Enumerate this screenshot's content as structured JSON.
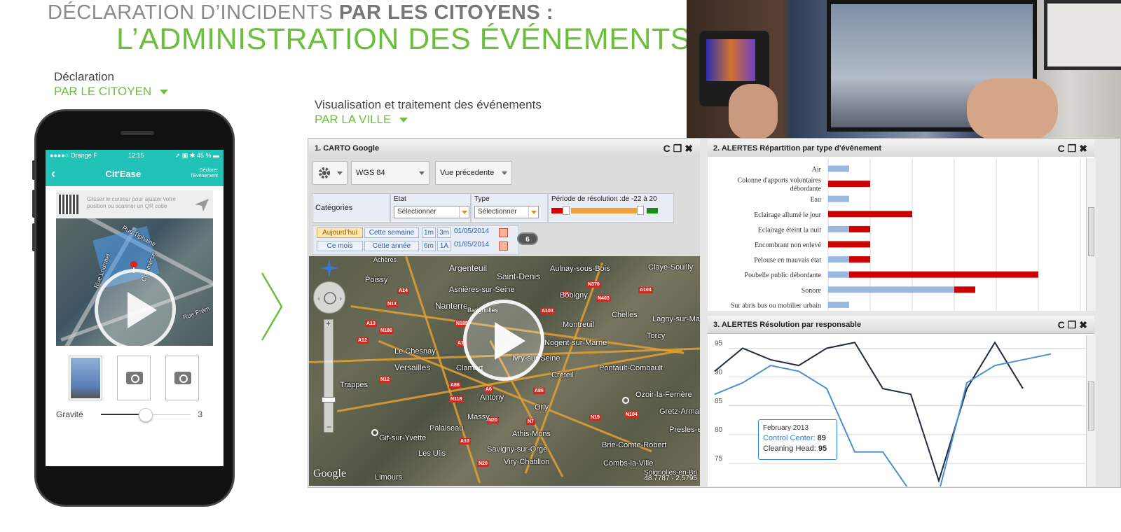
{
  "header": {
    "line1_plain": "DÉCLARATION D’INCIDENTS ",
    "line1_bold": "PAR LES CITOYENS :",
    "line2": "L’ADMINISTRATION DES ÉVÉNEMENTS"
  },
  "citizen": {
    "label": "Déclaration",
    "sub": "PAR LE CITOYEN"
  },
  "city": {
    "label": "Visualisation et traitement des événements",
    "sub": "PAR LA VILLE"
  },
  "phone": {
    "carrier": "●●●●○ Orange F",
    "time": "12:15",
    "battery": "45 %",
    "app_title": "Cit'Ease",
    "action_line1": "Déclarer",
    "action_line2": "l'Evènement",
    "hint": "Glisser le curseur pour ajuster votre position ou scanner un QR code",
    "map_labels": [
      "Rue Tiphaine",
      "Rue Lourmel",
      "Commerce",
      "Rue Frém"
    ],
    "gravity_label": "Gravité",
    "gravity_value": "3",
    "gravity_level": 0.5
  },
  "panel1": {
    "title": "1. CARTO Google",
    "projection": "WGS 84",
    "view": "Vue précedente",
    "categories_label": "Catégories",
    "etat_label": "Etat",
    "etat_value": "Sélectionner",
    "type_label": "Type",
    "type_value": "Sélectionner",
    "period_label": "Période de résolution :de -22 à 20",
    "date_buttons_row1": [
      "Aujourd'hui",
      "Cette semaine",
      "1m",
      "3m"
    ],
    "date_buttons_row2": [
      "Ce mois",
      "Cette année",
      "6m",
      "1A"
    ],
    "date1": "01/05/2014",
    "date2": "01/05/2014",
    "badge": "6",
    "map_labels": [
      "Argenteuil",
      "Saint-Denis",
      "Aulnay-sous-Bois",
      "Claye-Souilly",
      "Poissy",
      "Asnières-sur-Seine",
      "Bobigny",
      "Nanterre",
      "Batignolles",
      "Chelles",
      "Lagny-sur-Ma",
      "Montreuil",
      "Le Chesnay",
      "Nogent-sur-Marne",
      "Torcy",
      "Versailles",
      "Clamart",
      "Ivry-sur-Seine",
      "Pontault-Combault",
      "Trappes",
      "Créteil",
      "Antony",
      "Orly",
      "Ozoir-la-Ferrière",
      "Massy",
      "Gretz-Armai",
      "Palaiseau",
      "Athis-Mons",
      "Gif-sur-Yvette",
      "Presles-e",
      "Les Ulis",
      "Savigny-sur-Orge",
      "Brie-Comte-Robert",
      "Viry-Châtillon",
      "Combs-la-Ville",
      "Soignolles-en-Bri",
      "Limours",
      "Achères"
    ],
    "google": "Google",
    "coords": "48.7787 · 2.5795"
  },
  "panel2": {
    "title": "2. ALERTES Répartition par type d'évènement"
  },
  "panel3": {
    "title": "3. ALERTES Résolution par responsable",
    "tooltip_date": "February 2013",
    "tooltip_s1_label": "Control Center:",
    "tooltip_s1_value": "89",
    "tooltip_s2_label": "Cleaning Head:",
    "tooltip_s2_value": "95"
  },
  "icons": {
    "refresh": "C",
    "restore": "❐",
    "close": "✖"
  },
  "colors": {
    "green": "#6cbf3c",
    "teal": "#21c2b7",
    "bar_red": "#cc0000",
    "bar_blue": "#9ab8e0",
    "line_dark": "#1f2a44",
    "line_blue": "#4a90d0"
  },
  "chart_data": [
    {
      "type": "bar",
      "orientation": "horizontal",
      "stacked": true,
      "categories": [
        "Air",
        "Colonne d'apports volontaires débordante",
        "Eau",
        "Eclairage allumé le jour",
        "Eclairage éteint la nuit",
        "Encombrant non enlevé",
        "Pelouse en mauvais état",
        "Poubelle public débordante",
        "Sonore",
        "Sur abris bus ou mobilier urbain"
      ],
      "category_lines": [
        [
          "Air"
        ],
        [
          "Colonne d'apports volontaires",
          "débordante"
        ],
        [
          "Eau"
        ],
        [
          "Eclairage allumé le jour"
        ],
        [
          "Eclairage éteint la nuit"
        ],
        [
          "Encombrant non enlevé"
        ],
        [
          "Pelouse en mauvais état"
        ],
        [
          "Poubelle public débordante"
        ],
        [
          "Sonore"
        ],
        [
          "Sur abris bus ou mobilier urbain"
        ]
      ],
      "series": [
        {
          "color": "#9ab8e0",
          "values": [
            1,
            0,
            1,
            0,
            1,
            0,
            1,
            1,
            6,
            1
          ]
        },
        {
          "color": "#cc0000",
          "values": [
            0,
            2,
            0,
            4,
            1,
            2,
            1,
            9,
            1,
            0
          ]
        }
      ],
      "xlim": [
        0,
        14
      ],
      "grid": true
    },
    {
      "type": "line",
      "y_ticks": [
        75,
        80,
        85,
        90,
        95
      ],
      "ylim": [
        71,
        97
      ],
      "series": [
        {
          "color": "#1f2a44",
          "values": [
            91,
            95,
            93,
            92,
            95,
            96,
            88,
            87,
            72,
            88,
            96,
            88
          ]
        },
        {
          "color": "#4a90d0",
          "values": [
            87,
            89,
            92,
            91,
            88,
            77,
            77,
            70,
            70,
            89,
            92,
            93,
            94
          ]
        }
      ],
      "grid": true,
      "tooltip_index": 2
    }
  ]
}
